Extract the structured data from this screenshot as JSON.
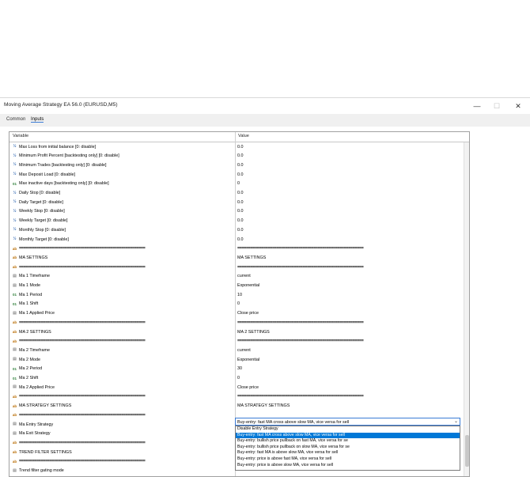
{
  "window": {
    "title": "Moving Average Strategy EA 56.0 (EURUSD,M5)",
    "minimize": "—",
    "maximize": "☐",
    "close": "✕"
  },
  "tabs": [
    {
      "label": "Common"
    },
    {
      "label": "Inputs",
      "active": true
    }
  ],
  "table": {
    "col_variable": "Variable",
    "col_value": "Value",
    "rows": [
      {
        "icon": "double",
        "name": "Max Loss from initial balance [0: disable]",
        "value": "0.0"
      },
      {
        "icon": "double",
        "name": "Minimum Profit Percent [backtesting only] [0: disable]",
        "value": "0.0"
      },
      {
        "icon": "double",
        "name": "Minimum Trades [backtesting only] [0: disable]",
        "value": "0.0"
      },
      {
        "icon": "double",
        "name": "Max Deposit Load [0: disable]",
        "value": "0.0"
      },
      {
        "icon": "int",
        "name": "Max inactive days [backtesting only] [0: disable]",
        "value": "0"
      },
      {
        "icon": "double",
        "name": "Daily Stop [0: disable]",
        "value": "0.0"
      },
      {
        "icon": "double",
        "name": "Daily Target [0: disable]",
        "value": "0.0"
      },
      {
        "icon": "double",
        "name": "Weekly Stop [0: disable]",
        "value": "0.0"
      },
      {
        "icon": "double",
        "name": "Weekly Target [0: disable]",
        "value": "0.0"
      },
      {
        "icon": "double",
        "name": "Monthly Stop [0: disable]",
        "value": "0.0"
      },
      {
        "icon": "double",
        "name": "Monthly Target [0: disable]",
        "value": "0.0"
      },
      {
        "icon": "string",
        "name": "==========================================================",
        "value": "==========================================================",
        "sep": true
      },
      {
        "icon": "string",
        "name": "MA SETTINGS",
        "value": "MA SETTINGS"
      },
      {
        "icon": "string",
        "name": "==========================================================",
        "value": "==========================================================",
        "sep": true
      },
      {
        "icon": "enum",
        "name": "Ma 1 Timeframe",
        "value": "current"
      },
      {
        "icon": "enum",
        "name": "Ma 1 Mode",
        "value": "Exponential"
      },
      {
        "icon": "int",
        "name": "Ma 1 Period",
        "value": "10"
      },
      {
        "icon": "int",
        "name": "Ma 1 Shift",
        "value": "0"
      },
      {
        "icon": "enum",
        "name": "Ma 1 Applied Price",
        "value": "Close price"
      },
      {
        "icon": "string",
        "name": "==========================================================",
        "value": "==========================================================",
        "sep": true
      },
      {
        "icon": "string",
        "name": "MA 2 SETTINGS",
        "value": "MA 2 SETTINGS"
      },
      {
        "icon": "string",
        "name": "==========================================================",
        "value": "==========================================================",
        "sep": true
      },
      {
        "icon": "enum",
        "name": "Ma 2 Timeframe",
        "value": "current"
      },
      {
        "icon": "enum",
        "name": "Ma 2 Mode",
        "value": "Exponential"
      },
      {
        "icon": "int",
        "name": "Ma 2 Period",
        "value": "30"
      },
      {
        "icon": "int",
        "name": "Ma 2 Shift",
        "value": "0"
      },
      {
        "icon": "enum",
        "name": "Ma 2 Applied Price",
        "value": "Close price"
      },
      {
        "icon": "string",
        "name": "==========================================================",
        "value": "==========================================================",
        "sep": true
      },
      {
        "icon": "string",
        "name": "MA STRATEGY SETTINGS",
        "value": "MA STRATEGY SETTINGS"
      },
      {
        "icon": "string",
        "name": "==========================================================",
        "value": "",
        "sep": true
      },
      {
        "icon": "enum",
        "name": "Ma Entry Strategy",
        "value": ""
      },
      {
        "icon": "enum",
        "name": "Ma Exit Strategy",
        "value": ""
      },
      {
        "icon": "string",
        "name": "==========================================================",
        "value": "",
        "sep": true
      },
      {
        "icon": "string",
        "name": "TREND FILTER SETTINGS",
        "value": ""
      },
      {
        "icon": "string",
        "name": "==========================================================",
        "value": "",
        "sep": true
      },
      {
        "icon": "enum",
        "name": "Trend filter gating mode",
        "value": ""
      }
    ]
  },
  "entry_select": {
    "value": "Buy-entry: fast MA cross above slow MA, vice versa for sell",
    "chevron": "⌄",
    "options": [
      "Disable Entry Strategy",
      "Buy-entry: fast MA cross above slow MA, vice versa for sell",
      "Buy-entry: bullish price pullback on fast MA, vice versa for se",
      "Buy-entry: bullish price pullback on slow MA, vice versa for se",
      "Buy-entry: fast MA is above slow MA, vice versa for sell",
      "Buy-entry: price is above fast MA, vice versa for sell",
      "Buy-entry: price is above slow MA, vice versa for sell"
    ],
    "selected_index": 1
  },
  "icons": {
    "double": "½",
    "int": "01",
    "string": "ab",
    "enum": "▤"
  }
}
